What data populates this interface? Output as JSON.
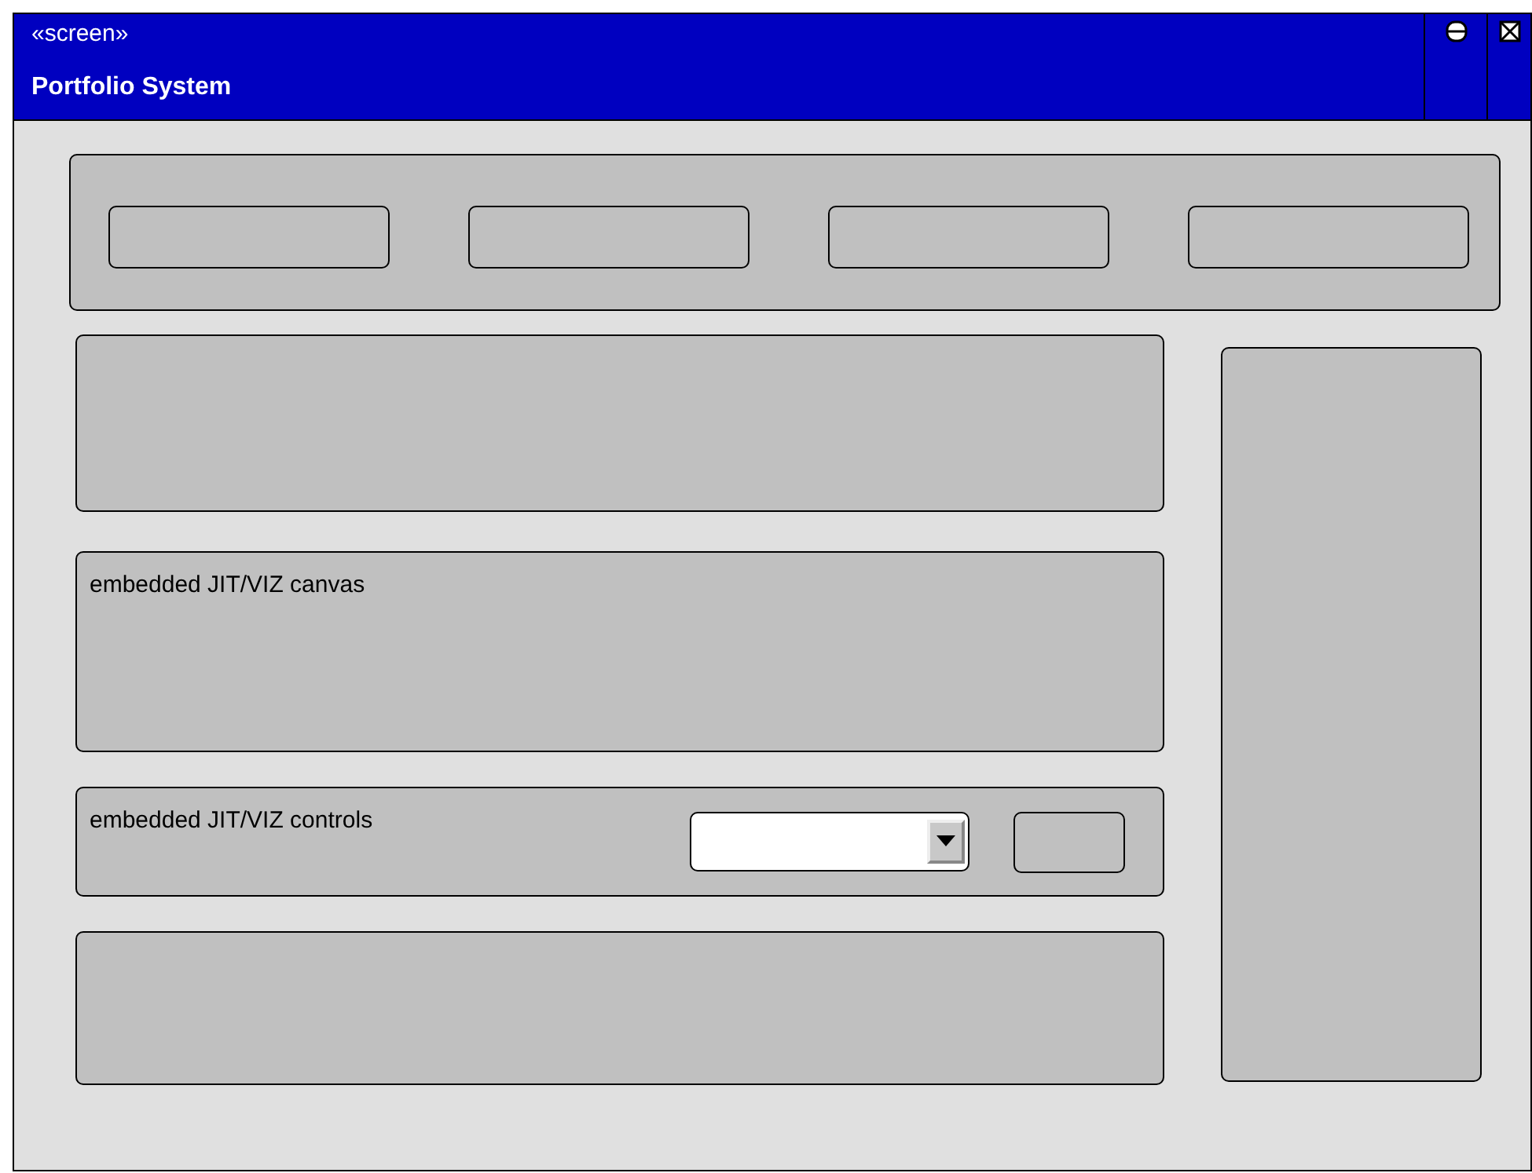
{
  "window": {
    "stereotype": "«screen»",
    "title": "Portfolio System"
  },
  "title_buttons": [
    {
      "kind": "minimize"
    },
    {
      "kind": "close"
    }
  ],
  "toolbar_buttons": [
    {
      "kind": "button"
    },
    {
      "kind": "button"
    },
    {
      "kind": "button"
    },
    {
      "kind": "button"
    }
  ],
  "panels": [
    {
      "kind": "blank"
    },
    {
      "kind": "canvas",
      "label": "embedded JIT/VIZ canvas"
    },
    {
      "kind": "controls",
      "label": "embedded JIT/VIZ controls",
      "controls": [
        {
          "kind": "dropdown"
        },
        {
          "kind": "button"
        }
      ]
    },
    {
      "kind": "blank"
    }
  ],
  "side_panel": {
    "kind": "blank"
  }
}
